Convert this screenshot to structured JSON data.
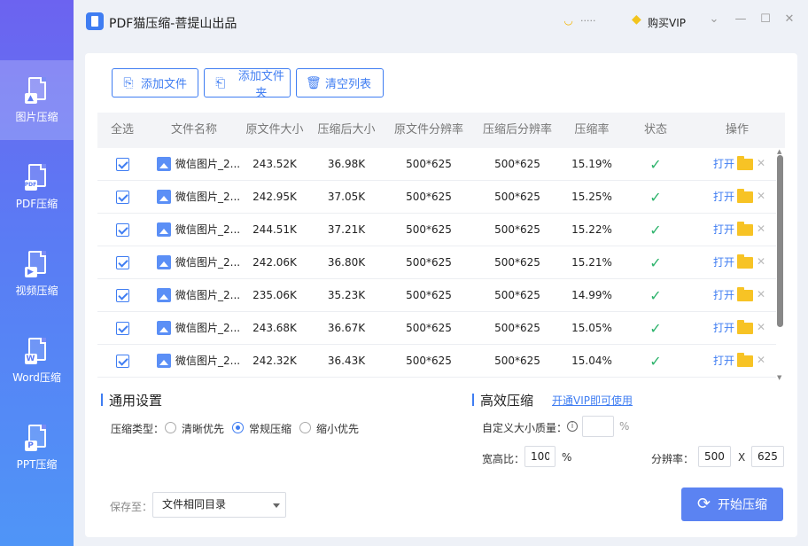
{
  "app": {
    "title": "PDF猫压缩-菩提山出品"
  },
  "user": {
    "name_masked": "·····",
    "vip_label": "购买VIP"
  },
  "sidebar": {
    "items": [
      {
        "label": "图片压缩",
        "badge": ""
      },
      {
        "label": "PDF压缩",
        "badge": "PDF"
      },
      {
        "label": "视频压缩",
        "badge": "▶"
      },
      {
        "label": "Word压缩",
        "badge": "W"
      },
      {
        "label": "PPT压缩",
        "badge": "P"
      }
    ]
  },
  "toolbar": {
    "add_file": "添加文件",
    "add_folder": "添加文件夹",
    "clear_list": "清空列表"
  },
  "table": {
    "headers": [
      "全选",
      "文件名称",
      "原文件大小",
      "压缩后大小",
      "原文件分辨率",
      "压缩后分辨率",
      "压缩率",
      "状态",
      "操作"
    ],
    "open_label": "打开",
    "rows": [
      {
        "name": "微信图片_2...",
        "orig": "243.52K",
        "comp": "36.98K",
        "orig_res": "500*625",
        "comp_res": "500*625",
        "rate": "15.19%"
      },
      {
        "name": "微信图片_2...",
        "orig": "242.95K",
        "comp": "37.05K",
        "orig_res": "500*625",
        "comp_res": "500*625",
        "rate": "15.25%"
      },
      {
        "name": "微信图片_2...",
        "orig": "244.51K",
        "comp": "37.21K",
        "orig_res": "500*625",
        "comp_res": "500*625",
        "rate": "15.22%"
      },
      {
        "name": "微信图片_2...",
        "orig": "242.06K",
        "comp": "36.80K",
        "orig_res": "500*625",
        "comp_res": "500*625",
        "rate": "15.21%"
      },
      {
        "name": "微信图片_2...",
        "orig": "235.06K",
        "comp": "35.23K",
        "orig_res": "500*625",
        "comp_res": "500*625",
        "rate": "14.99%"
      },
      {
        "name": "微信图片_2...",
        "orig": "243.68K",
        "comp": "36.67K",
        "orig_res": "500*625",
        "comp_res": "500*625",
        "rate": "15.05%"
      },
      {
        "name": "微信图片_2...",
        "orig": "242.32K",
        "comp": "36.43K",
        "orig_res": "500*625",
        "comp_res": "500*625",
        "rate": "15.04%"
      }
    ]
  },
  "settings": {
    "general_title": "通用设置",
    "compress_type_label": "压缩类型：",
    "options": [
      "清晰优先",
      "常规压缩",
      "缩小优先"
    ],
    "selected_option": "常规压缩",
    "efficient_title": "高效压缩",
    "vip_link": "开通VIP即可使用",
    "custom_quality_label": "自定义大小质量：",
    "custom_quality_value": "",
    "percent": "%",
    "ratio_label": "宽高比：",
    "ratio_value": "100",
    "resolution_label": "分辨率：",
    "res_width": "500",
    "res_x": "X",
    "res_height": "625"
  },
  "footer": {
    "save_to_label": "保存至：",
    "save_to_value": "文件相同目录",
    "start_button": "开始压缩"
  },
  "colors": {
    "accent": "#3f7df2",
    "success": "#2cb36b",
    "folder": "#f7c325"
  }
}
